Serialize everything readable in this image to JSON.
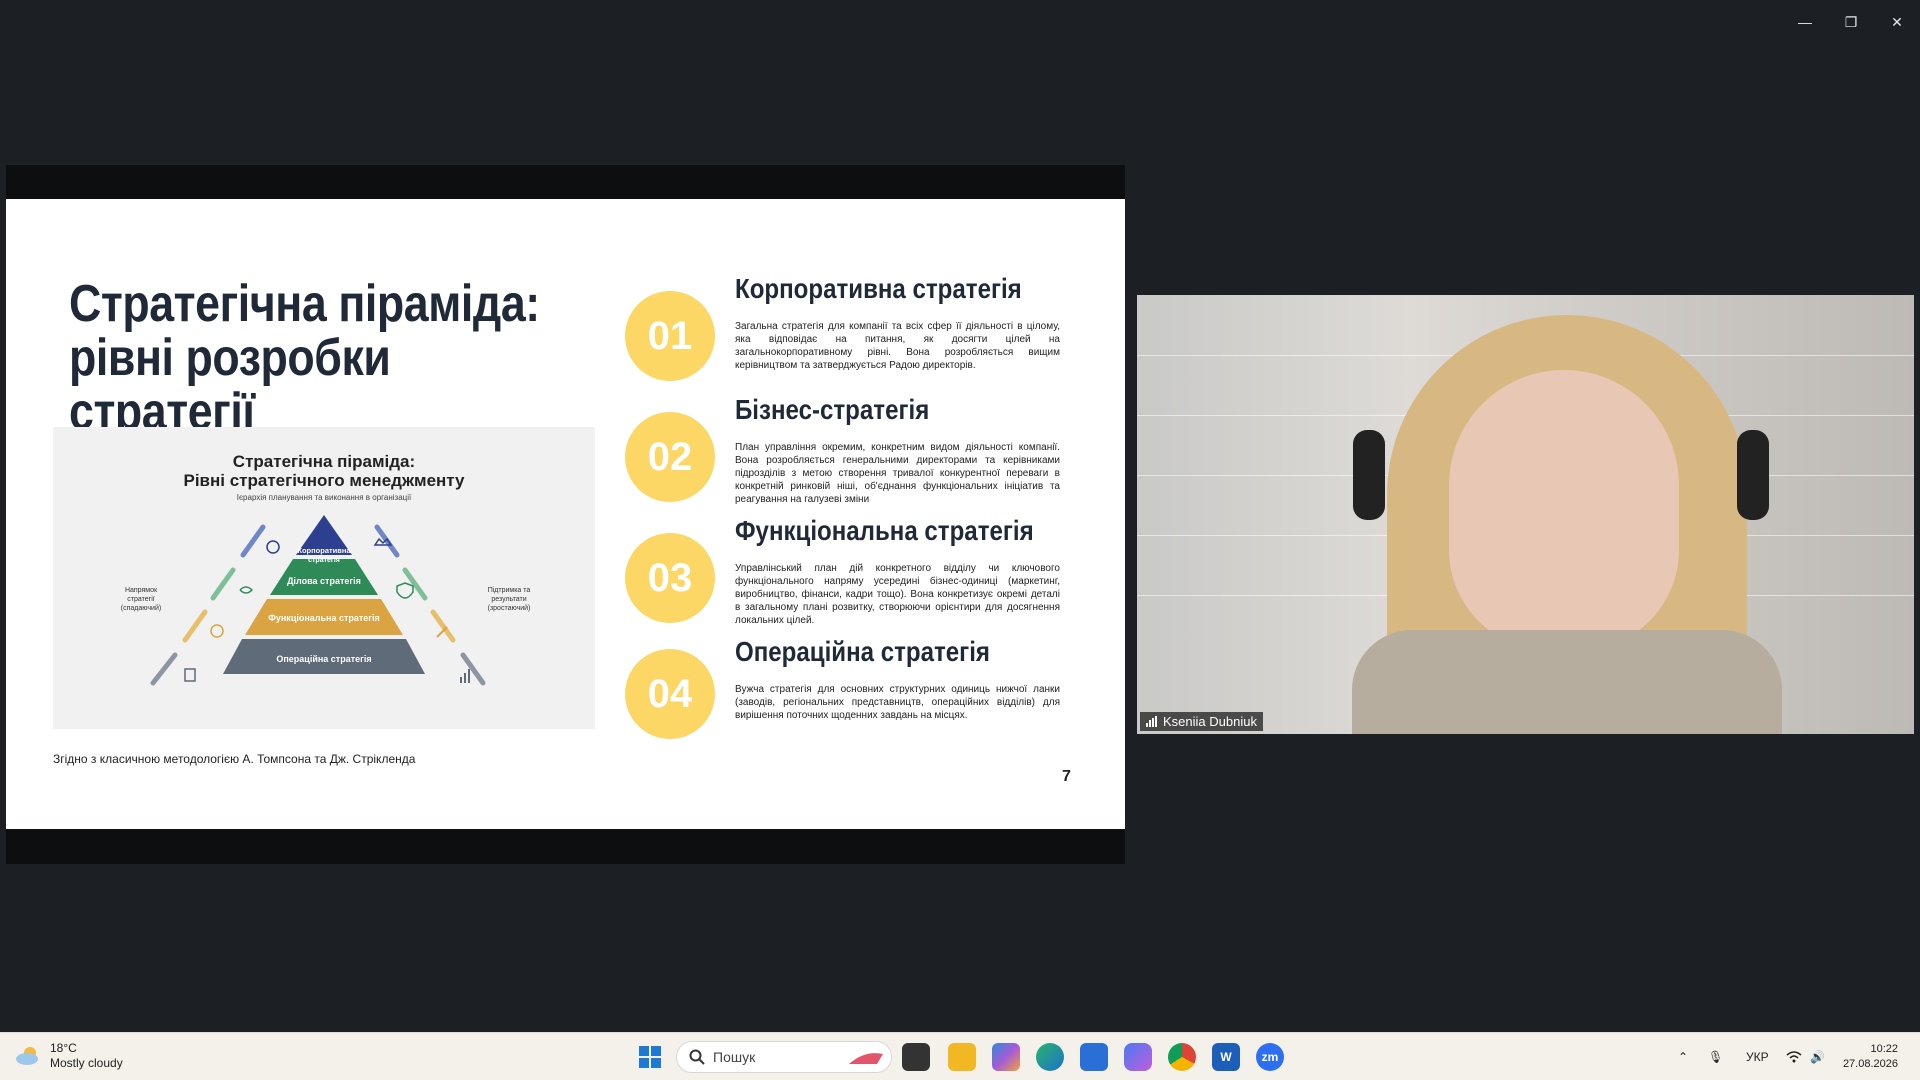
{
  "window": {
    "minimize": "—",
    "restore": "❐",
    "close": "✕"
  },
  "slide": {
    "title_line1": "Стратегічна піраміда:",
    "title_line2": "рівні розробки стратегії",
    "footnote": "Згідно з класичною методологією А. Томпсона та Дж. Стрікленда",
    "page": "7",
    "infographic": {
      "title1": "Стратегічна піраміда:",
      "title2": "Рівні стратегічного менеджменту",
      "subtitle": "Ієрархія планування та виконання в організації",
      "level1a": "Корпоративна",
      "level1b": "стратегія",
      "level2": "Ділова стратегія",
      "level3": "Функціональна стратегія",
      "level4": "Операційна стратегія",
      "left_a": "Напрямок",
      "left_b": "стратегії",
      "left_c": "(спадаючий)",
      "right_a": "Підтримка та",
      "right_b": "результати",
      "right_c": "(зростаючий)",
      "colors": {
        "level1": "#2d3f8f",
        "level2": "#2e8b57",
        "level3": "#d9a441",
        "level4": "#5f6b78"
      }
    },
    "items": [
      {
        "num": "01",
        "heading": "Корпоративна стратегія",
        "text": "Загальна стратегія для компанії та всіх сфер її діяльності в цілому, яка відповідає на питання, як досягти цілей на загальнокорпоративному рівні. Вона розробляється вищим керівництвом та затверджується Радою директорів."
      },
      {
        "num": "02",
        "heading": "Бізнес-стратегія",
        "text": "План управління окремим, конкретним видом діяльності компанії. Вона розробляється генеральними директорами та керівниками підрозділів з метою створення тривалої конкурентної переваги в конкретній ринковій ніші, об'єднання функціональних ініціатив та реагування на галузеві зміни"
      },
      {
        "num": "03",
        "heading": "Функціональна стратегія",
        "text": "Управлінський план дій конкретного відділу чи ключового функціонального напряму усередині бізнес-одиниці (маркетинг, виробництво, фінанси, кадри тощо). Вона конкретизує окремі деталі в загальному плані розвитку, створюючи орієнтири для досягнення локальних цілей."
      },
      {
        "num": "04",
        "heading": "Операційна стратегія",
        "text": "Вужча стратегія для основних структурних одиниць нижчої ланки (заводів, регіональних представництв, операційних відділів) для вирішення поточних щоденних завдань на місцях."
      }
    ],
    "accent": "#fcd765"
  },
  "video": {
    "name": "Kseniia Dubniuk"
  },
  "taskbar": {
    "weather_temp": "18°C",
    "weather_desc": "Mostly cloudy",
    "search_placeholder": "Пошук",
    "lang": "УКР",
    "time": "10:22",
    "date": "27.08.2026",
    "apps": [
      "start-icon",
      "task-view-icon",
      "file-explorer-icon",
      "microsoft-365-icon",
      "edge-icon",
      "store-icon",
      "copilot-icon",
      "chrome-icon",
      "word-icon",
      "zoom-icon"
    ]
  }
}
